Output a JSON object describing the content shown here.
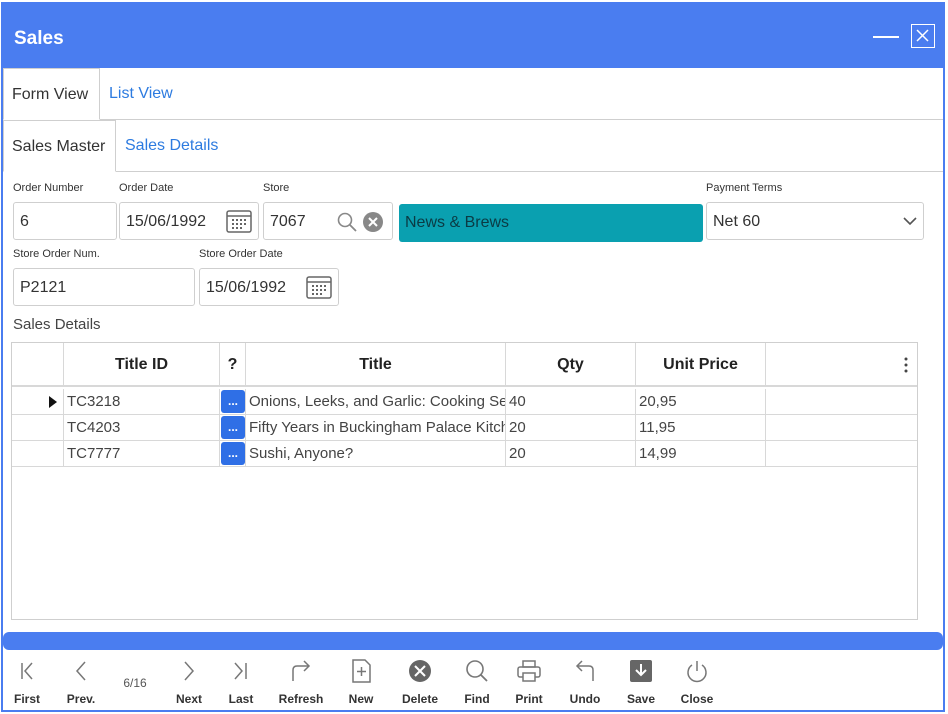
{
  "window": {
    "title": "Sales"
  },
  "view_tabs": [
    {
      "label": "Form View"
    },
    {
      "label": "List View"
    }
  ],
  "section_tabs": [
    {
      "label": "Sales Master"
    },
    {
      "label": "Sales Details"
    }
  ],
  "form": {
    "order_number": {
      "label": "Order Number",
      "value": "6"
    },
    "order_date": {
      "label": "Order Date",
      "value": "15/06/1992"
    },
    "store": {
      "label": "Store",
      "value": "7067",
      "name": "News & Brews"
    },
    "payment_terms": {
      "label": "Payment Terms",
      "value": "Net 60"
    },
    "store_order_num": {
      "label": "Store Order Num.",
      "value": "P2121"
    },
    "store_order_date": {
      "label": "Store Order Date",
      "value": "15/06/1992"
    }
  },
  "details": {
    "label": "Sales Details",
    "columns": [
      "Title ID",
      "?",
      "Title",
      "Qty",
      "Unit Price"
    ],
    "rows": [
      {
        "title_id": "TC3218",
        "title": "Onions, Leeks, and Garlic: Cooking Secrets of the Mediterranean",
        "qty": "40",
        "price": "20,95"
      },
      {
        "title_id": "TC4203",
        "title": "Fifty Years in Buckingham Palace Kitchens",
        "qty": "20",
        "price": "11,95"
      },
      {
        "title_id": "TC7777",
        "title": "Sushi, Anyone?",
        "qty": "20",
        "price": "14,99"
      }
    ],
    "dot_label": "..."
  },
  "toolbar": {
    "page_info": "6/16",
    "buttons": [
      {
        "label": "First",
        "icon": "first-icon"
      },
      {
        "label": "Prev.",
        "icon": "prev-icon"
      },
      {
        "label": "Next",
        "icon": "next-icon"
      },
      {
        "label": "Last",
        "icon": "last-icon"
      },
      {
        "label": "Refresh",
        "icon": "refresh-icon"
      },
      {
        "label": "New",
        "icon": "new-icon"
      },
      {
        "label": "Delete",
        "icon": "delete-icon"
      },
      {
        "label": "Find",
        "icon": "find-icon"
      },
      {
        "label": "Print",
        "icon": "print-icon"
      },
      {
        "label": "Undo",
        "icon": "undo-icon"
      },
      {
        "label": "Save",
        "icon": "save-icon"
      },
      {
        "label": "Close",
        "icon": "close-icon"
      }
    ]
  },
  "colors": {
    "accent": "#4a7df0",
    "store_name_bg": "#0aa0b0",
    "link": "#2d7be0"
  }
}
